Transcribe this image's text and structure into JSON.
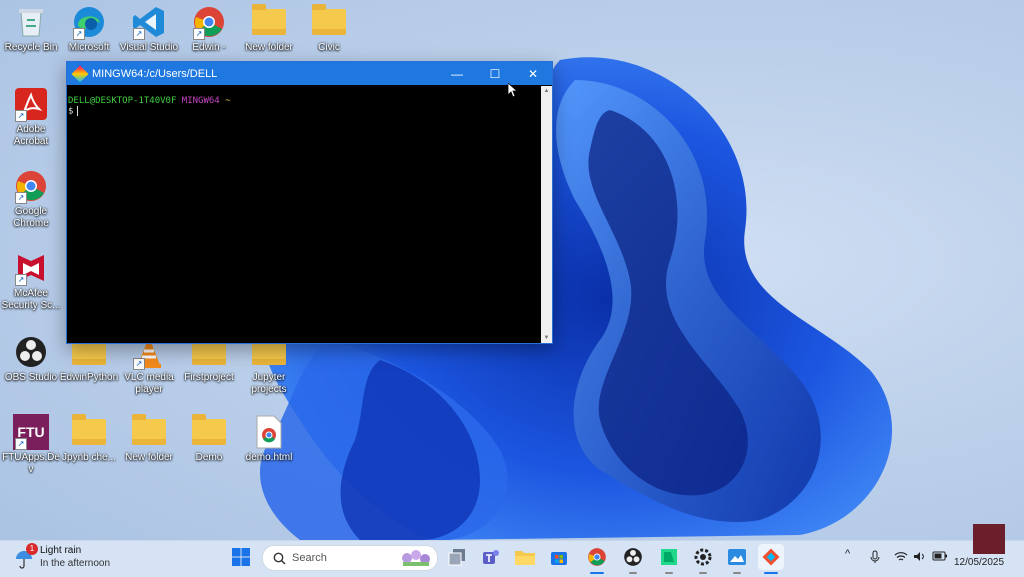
{
  "desktop": {
    "icons": [
      {
        "label": "Recycle Bin"
      },
      {
        "label": "Microsoft"
      },
      {
        "label": "Visual Studio"
      },
      {
        "label": "Edwin -"
      },
      {
        "label": "New folder"
      },
      {
        "label": "Civic"
      },
      {
        "label": "Adobe Acrobat"
      },
      {
        "label": "Google Chrome"
      },
      {
        "label": "McAfee Security Sc..."
      },
      {
        "label": "OBS Studio"
      },
      {
        "label": "EdwinPython"
      },
      {
        "label": "VLC media player"
      },
      {
        "label": "Firstproject"
      },
      {
        "label": "Jupyter projects"
      },
      {
        "label": "FTUApps.Dev"
      },
      {
        "label": "Jpynb che..."
      },
      {
        "label": "New folder"
      },
      {
        "label": "Demo"
      },
      {
        "label": "demo.html"
      }
    ],
    "ftu_text": "FTU"
  },
  "terminal": {
    "title": "MINGW64:/c/Users/DELL",
    "prompt_user": "DELL@DESKTOP-1T40V0F",
    "prompt_sys": "MINGW64",
    "prompt_path": "~",
    "prompt_symbol": "$",
    "minimize_glyph": "—",
    "maximize_glyph": "☐",
    "close_glyph": "✕"
  },
  "taskbar": {
    "weather_title": "Light rain",
    "weather_sub": "In the afternoon",
    "weather_badge": "1",
    "search_placeholder": "Search",
    "date": "12/05/2025",
    "tray_chevron": "^"
  },
  "colors": {
    "accent": "#1f78e0",
    "prompt_user": "#3fcf3f",
    "prompt_sys": "#c545c5",
    "prompt_path": "#d9c84b"
  }
}
